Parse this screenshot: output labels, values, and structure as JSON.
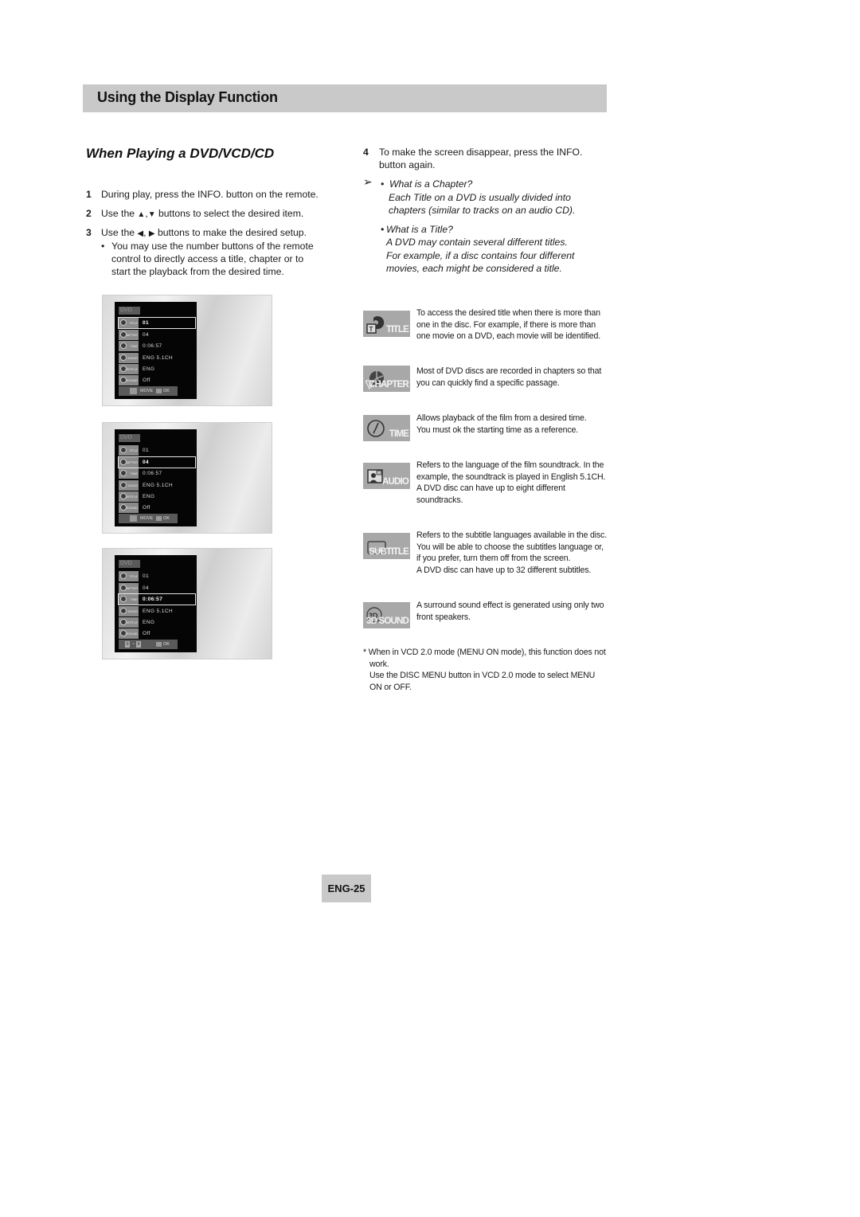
{
  "header": {
    "title": "Using the Display Function"
  },
  "section": {
    "title": "When Playing a DVD/VCD/CD"
  },
  "steps": [
    {
      "num": "1",
      "text": "During play, press the INFO. button on the remote."
    },
    {
      "num": "2",
      "text_before": "Use the",
      "text_after": "buttons to select the desired item.",
      "icons": [
        "up-arrow",
        "down-arrow"
      ]
    },
    {
      "num": "3",
      "text_before": "Use the",
      "text_after": "buttons to make the desired setup.",
      "icons": [
        "left-arrow",
        "right-arrow"
      ]
    }
  ],
  "step3_bullet": {
    "lines": [
      "You may use the number buttons of the remote",
      "control to directly access a title, chapter or to",
      "start the playback from the desired time."
    ]
  },
  "step4": {
    "num": "4",
    "lines": [
      "To make the screen disappear, press the INFO.",
      "button again."
    ]
  },
  "notes": {
    "arrow_icon": "right-arrowhead",
    "chapter": {
      "heading": "What is a Chapter?",
      "lines": [
        "Each Title on a DVD is usually divided into",
        "chapters (similar to  tracks on an audio CD)."
      ]
    },
    "title": {
      "heading": "What is a Title?",
      "lines": [
        "A DVD may contain several different titles.",
        "For example, if a disc contains four different",
        "movies, each might be considered a title."
      ]
    }
  },
  "osd_screens": [
    {
      "disc": "DVD",
      "selected": 0,
      "rows": [
        {
          "label": "TITLE",
          "value": "01"
        },
        {
          "label": "CHAPTER",
          "value": "04"
        },
        {
          "label": "TIME",
          "value": "0:06:57"
        },
        {
          "label": "AUDIO",
          "value": "ENG 5.1CH"
        },
        {
          "label": "SUBTITLE",
          "value": "ENG"
        },
        {
          "label": "3D SOUND",
          "value": "Off"
        }
      ],
      "footer": {
        "type": "move",
        "move": "MOVE",
        "ok": "OK"
      }
    },
    {
      "disc": "DVD",
      "selected": 1,
      "rows": [
        {
          "label": "TITLE",
          "value": "01"
        },
        {
          "label": "CHAPTER",
          "value": "04"
        },
        {
          "label": "TIME",
          "value": "0:06:57"
        },
        {
          "label": "AUDIO",
          "value": "ENG 5.1CH"
        },
        {
          "label": "SUBTITLE",
          "value": "ENG"
        },
        {
          "label": "3D SOUND",
          "value": "Off"
        }
      ],
      "footer": {
        "type": "move",
        "move": "MOVE",
        "ok": "OK"
      }
    },
    {
      "disc": "DVD",
      "selected": 2,
      "rows": [
        {
          "label": "TITLE",
          "value": "01"
        },
        {
          "label": "CHAPTER",
          "value": "04"
        },
        {
          "label": "TIME",
          "value": "0:06:57"
        },
        {
          "label": "AUDIO",
          "value": "ENG 5.1CH"
        },
        {
          "label": "SUBTITLE",
          "value": "ENG"
        },
        {
          "label": "3D SOUND",
          "value": "Off"
        }
      ],
      "footer": {
        "type": "numbers",
        "from": "0",
        "sep": "~",
        "to": "9",
        "ok": "OK"
      }
    }
  ],
  "features": [
    {
      "icon": "title-icon",
      "label": "TITLE",
      "lines": [
        "To access the desired title when there is more than",
        "one in the disc. For example, if there is more than",
        "one movie on a DVD, each movie will be identified."
      ]
    },
    {
      "icon": "chapter-icon",
      "label": "CHAPTER",
      "lines": [
        "Most of DVD discs are recorded in chapters so that",
        "you can quickly find a specific passage."
      ]
    },
    {
      "icon": "time-icon",
      "label": "TIME",
      "lines": [
        "Allows playback of the film from a desired time.",
        "You must ok the starting time as a reference."
      ]
    },
    {
      "icon": "audio-icon",
      "label": "AUDIO",
      "lines": [
        "Refers to the language of the film soundtrack. In the",
        "example, the soundtrack is played in English 5.1CH.",
        "A DVD disc can have up to eight different",
        "soundtracks."
      ]
    },
    {
      "icon": "subtitle-icon",
      "label": "SUBTITLE",
      "lines": [
        "Refers to the subtitle languages available in the disc.",
        "You will be able to choose the subtitles language or,",
        "if you prefer, turn them off from the screen.",
        "A DVD disc can have up to 32 different subtitles."
      ]
    },
    {
      "icon": "3d-sound-icon",
      "label": "3D SOUND",
      "lines": [
        "A surround sound effect is generated using only two",
        "front speakers."
      ]
    }
  ],
  "footnote": {
    "lines": [
      "* When in VCD 2.0 mode (MENU ON mode), this function does not",
      "work.",
      "Use the DISC MENU button in VCD 2.0 mode to select MENU",
      "ON or OFF."
    ]
  },
  "page_number": "ENG-25"
}
